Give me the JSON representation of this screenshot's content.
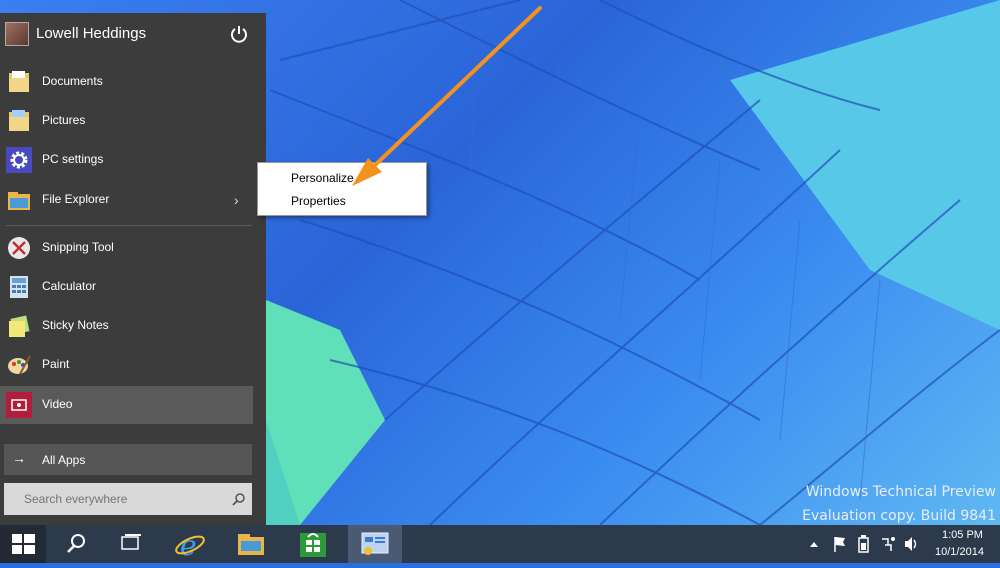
{
  "desktop": {
    "watermark_line1": "Windows Technical Preview",
    "watermark_line2": "Evaluation copy. Build 9841"
  },
  "start_menu": {
    "user_name": "Lowell Heddings",
    "pinned": [
      {
        "label": "Documents",
        "icon": "folder-documents-icon"
      },
      {
        "label": "Pictures",
        "icon": "folder-pictures-icon"
      },
      {
        "label": "PC settings",
        "icon": "gear-icon"
      },
      {
        "label": "File Explorer",
        "icon": "file-explorer-icon"
      }
    ],
    "recent": [
      {
        "label": "Snipping Tool",
        "icon": "snipping-tool-icon"
      },
      {
        "label": "Calculator",
        "icon": "calculator-icon"
      },
      {
        "label": "Sticky Notes",
        "icon": "sticky-notes-icon"
      },
      {
        "label": "Paint",
        "icon": "paint-icon"
      },
      {
        "label": "Video",
        "icon": "video-icon"
      }
    ],
    "all_apps_label": "All Apps",
    "search_placeholder": "Search everywhere"
  },
  "context_menu": {
    "items": [
      "Personalize",
      "Properties"
    ]
  },
  "taskbar": {
    "buttons": [
      "start-button",
      "search-button",
      "task-view-button",
      "internet-explorer-button",
      "file-explorer-button",
      "store-button",
      "control-panel-button"
    ],
    "tray_icons": [
      "show-hidden-icons-icon",
      "flag-icon",
      "power-icon",
      "network-icon",
      "volume-icon"
    ],
    "clock_time": "1:05 PM",
    "clock_date": "10/1/2014"
  },
  "colors": {
    "start_menu_bg": "#3c3c3c",
    "taskbar_bg": "#2d3a4b",
    "annotation_arrow": "#f5921e",
    "wallpaper_blue": "#2a65d8"
  }
}
